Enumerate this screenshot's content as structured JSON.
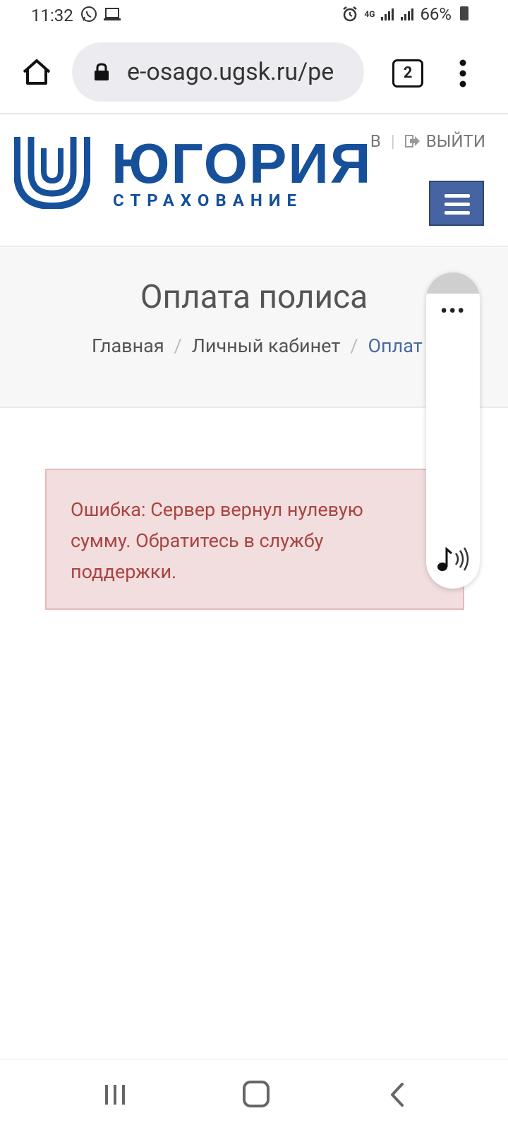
{
  "status_bar": {
    "time": "11:32",
    "network": "4G",
    "battery": "66%",
    "left_icons": [
      "whatsapp-icon",
      "laptop-icon"
    ],
    "right_icons": [
      "alarm-icon",
      "signal-icon",
      "signal-icon",
      "battery-icon"
    ]
  },
  "browser": {
    "url": "e-osago.ugsk.ru/pe",
    "tab_count": "2"
  },
  "header": {
    "brand_name": "ЮГОРИЯ",
    "brand_sub": "СТРАХОВАНИЕ",
    "user_link": "В",
    "separator": "|",
    "logout_label": "ВЫЙТИ",
    "brand_color": "#16509a",
    "menu_button_color": "#4663a2"
  },
  "hero": {
    "title": "Оплата полиса",
    "breadcrumb": [
      "Главная",
      "Личный кабинет",
      "Оплат"
    ],
    "breadcrumb_separator": "/"
  },
  "float_panel": {
    "dots": "•••"
  },
  "alert": {
    "message": "Ошибка: Сервер вернул нулевую сумму. Обратитесь в службу поддержки.",
    "text_color": "#a94442",
    "background": "#f2dede"
  }
}
